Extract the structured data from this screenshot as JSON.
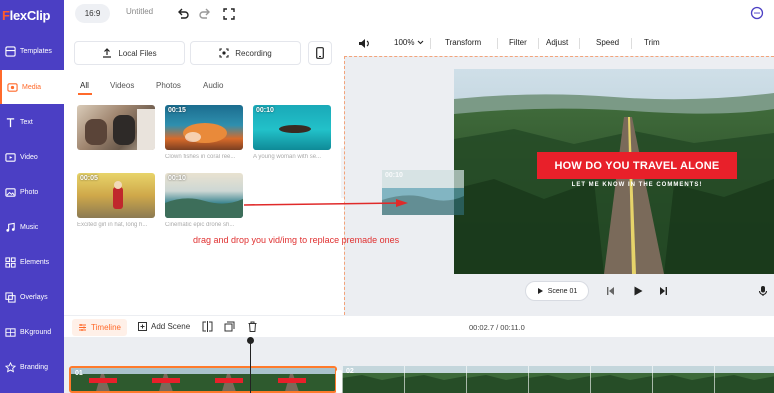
{
  "app": {
    "logo": "FlexClip",
    "logo_first": "F",
    "logo_rest": "lexClip",
    "brand_color": "#4b3fc4",
    "accent_color": "#ff6a2b"
  },
  "sidebar": {
    "items": [
      {
        "label": "Templates",
        "icon": "templates-icon"
      },
      {
        "label": "Media",
        "icon": "media-icon",
        "active": true
      },
      {
        "label": "Text",
        "icon": "text-icon"
      },
      {
        "label": "Video",
        "icon": "video-icon"
      },
      {
        "label": "Photo",
        "icon": "photo-icon"
      },
      {
        "label": "Music",
        "icon": "music-icon"
      },
      {
        "label": "Elements",
        "icon": "elements-icon"
      },
      {
        "label": "Overlays",
        "icon": "overlays-icon"
      },
      {
        "label": "BKground",
        "icon": "background-icon"
      },
      {
        "label": "Branding",
        "icon": "branding-icon"
      }
    ]
  },
  "header": {
    "ratio": "16:9",
    "title": "Untitled"
  },
  "media": {
    "local_files": "Local Files",
    "recording": "Recording",
    "tabs": [
      "All",
      "Videos",
      "Photos",
      "Audio"
    ],
    "thumbs": [
      {
        "duration": "",
        "caption": ""
      },
      {
        "duration": "00:15",
        "caption": "Clown fishes in coral ree..."
      },
      {
        "duration": "00:10",
        "caption": "A young woman with se..."
      },
      {
        "duration": "00:05",
        "caption": "Excited girl in hat, long h..."
      },
      {
        "duration": "00:10",
        "caption": "Cinematic epic drone sh..."
      }
    ],
    "instruction": "drag and drop you vid/img to replace premade ones"
  },
  "toolbar": {
    "zoom": "100%",
    "items": [
      "Transform",
      "Filter",
      "Adjust",
      "Speed",
      "Trim"
    ]
  },
  "preview": {
    "headline": "HOW DO YOU TRAVEL ALONE",
    "subline": "LET ME KNOW IN THE COMMENTS!",
    "drag_duration": "00:10",
    "scene_label": "Scene 01"
  },
  "timeline": {
    "label": "Timeline",
    "add_scene": "Add Scene",
    "timecode": "00:02.7 / 00:11.0",
    "clips": [
      "01",
      "02"
    ]
  }
}
